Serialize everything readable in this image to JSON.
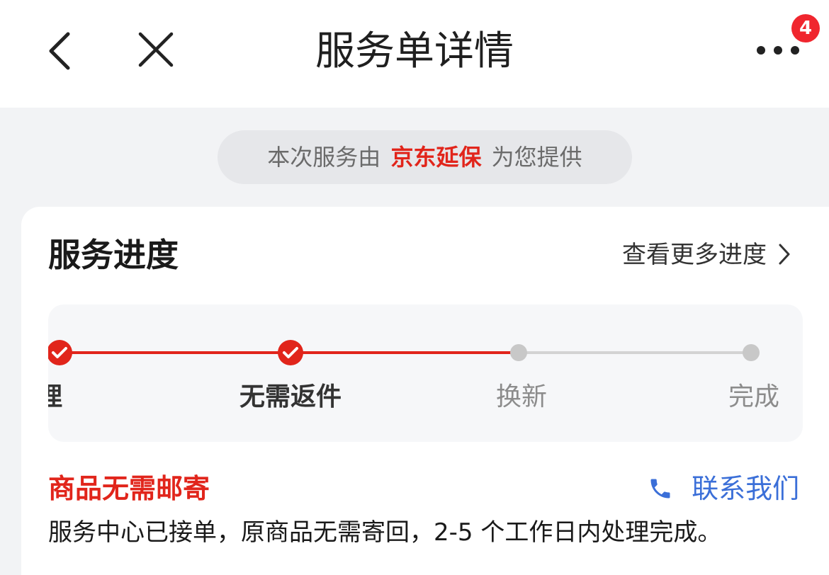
{
  "header": {
    "title": "服务单详情",
    "badge_count": "4"
  },
  "provider": {
    "prefix": "本次服务由",
    "brand": "京东延保",
    "suffix": "为您提供",
    "brand_color": "#e1251b"
  },
  "progress": {
    "title": "服务进度",
    "more_link": "查看更多进度",
    "steps": [
      {
        "label": "受理",
        "state": "done"
      },
      {
        "label": "无需返件",
        "state": "done"
      },
      {
        "label": "换新",
        "state": "pending"
      },
      {
        "label": "完成",
        "state": "pending"
      }
    ],
    "active_color": "#e1251b",
    "pending_color": "#c8c8c8"
  },
  "status": {
    "title": "商品无需邮寄",
    "contact_label": "联系我们",
    "contact_color": "#3b6fd8",
    "description": "服务中心已接单，原商品无需寄回，2-5 个工作日内处理完成。"
  }
}
